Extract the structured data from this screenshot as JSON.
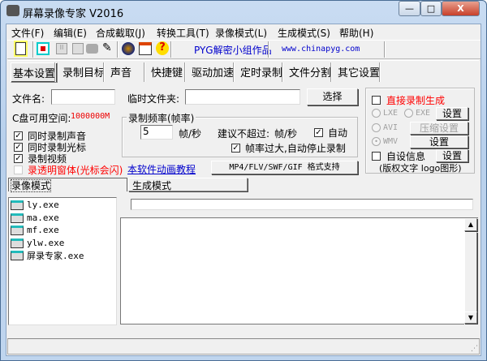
{
  "window": {
    "title": "屏幕录像专家 V2016",
    "minimize": "—",
    "maximize": "□",
    "close": "X"
  },
  "menu": [
    "文件(F)",
    "编辑(E)",
    "合成截取(J)",
    "转换工具(T)",
    "录像模式(L)",
    "生成模式(S)",
    "帮助(H)"
  ],
  "toolbar": {
    "pyg_label": "PYG解密小组作品",
    "url": "www.chinapyg.com"
  },
  "tabs": [
    "基本设置",
    "录制目标",
    "声音",
    "快捷键",
    "驱动加速",
    "定时录制",
    "文件分割",
    "其它设置"
  ],
  "basic": {
    "filename_label": "文件名:",
    "filename_value": "",
    "tempdir_label": "临时文件夹:",
    "tempdir_value": "",
    "select_button": "选择",
    "disk_label": "C盘可用空间:",
    "disk_value": "1000000M",
    "checkboxes": [
      {
        "label": "同时录制声音",
        "checked": true
      },
      {
        "label": "同时录制光标",
        "checked": true
      },
      {
        "label": "录制视频",
        "checked": true
      },
      {
        "label": "录透明窗体(光标会闪)",
        "checked": false
      }
    ],
    "tutorial_link": "本软件动画教程",
    "format_button": "MP4/FLV/SWF/GIF  格式支持",
    "rate_group": {
      "title": "录制频率(帧率)",
      "value": "5",
      "unit": "帧/秒",
      "suggest": "建议不超过:",
      "suggest_unit": "帧/秒",
      "auto_label": "自动",
      "auto_checked": true,
      "stop_label": "帧率过大,自动停止录制",
      "stop_checked": true
    }
  },
  "right_panel": {
    "direct_label": "直接录制生成",
    "direct_checked": false,
    "lxe": "LXE",
    "exe": "EXE",
    "avi": "AVI",
    "wmv": "WMV",
    "wmv_selected": true,
    "settings1": "设置",
    "compress": "压缩设置",
    "settings2": "设置",
    "custom_label": "自设信息",
    "custom_checked": false,
    "settings3": "设置",
    "custom_note": "(版权文字 logo图形)"
  },
  "bottom_tabs": [
    "录像模式",
    "生成模式"
  ],
  "files": [
    "ly.exe",
    "ma.exe",
    "mf.exe",
    "ylw.exe",
    "屏录专家.exe"
  ]
}
